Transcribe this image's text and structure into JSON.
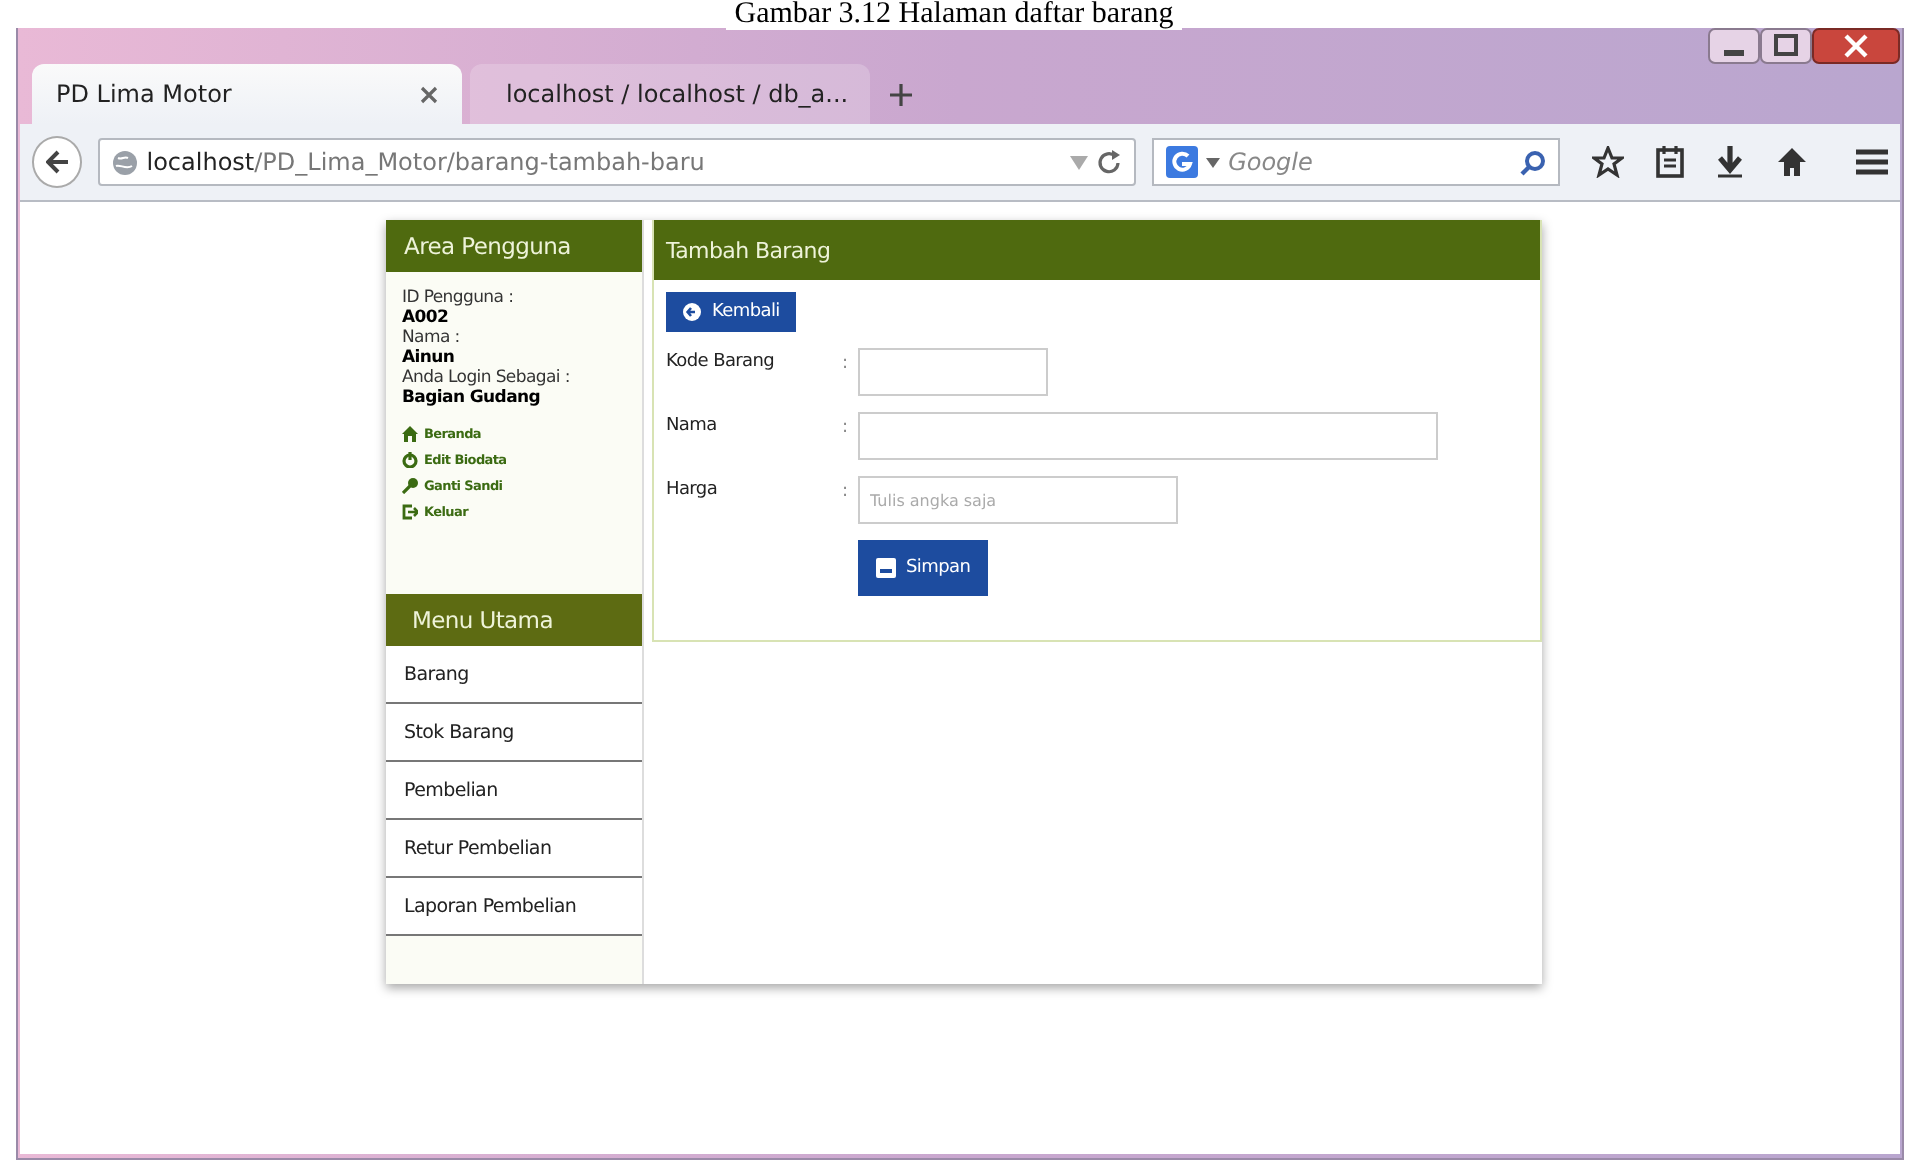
{
  "caption": "Gambar 3.12 Halaman daftar barang",
  "tabs": [
    {
      "label": "PD Lima Motor",
      "selected": true
    },
    {
      "label": "localhost / localhost / db_a...",
      "selected": false
    }
  ],
  "address_bar": {
    "host": "localhost",
    "path": "/PD_Lima_Motor/barang-tambah-baru"
  },
  "search": {
    "placeholder": "Google"
  },
  "user_area": {
    "title": "Area Pengguna",
    "fields": [
      {
        "label": "ID Pengguna :",
        "value": "A002"
      },
      {
        "label": "Nama :",
        "value": "Ainun"
      },
      {
        "label": "Anda Login Sebagai :",
        "value": "Bagian Gudang"
      }
    ],
    "links": [
      "Beranda",
      "Edit Biodata",
      "Ganti Sandi",
      "Keluar"
    ]
  },
  "menu": {
    "title": "Menu Utama",
    "items": [
      "Barang",
      "Stok Barang",
      "Pembelian",
      "Retur Pembelian",
      "Laporan Pembelian"
    ]
  },
  "form": {
    "title": "Tambah Barang",
    "back_button": "Kembali",
    "fields": [
      {
        "label": "Kode Barang",
        "separator": ":"
      },
      {
        "label": "Nama",
        "separator": ":"
      },
      {
        "label": "Harga",
        "separator": ":",
        "placeholder": "Tulis angka saja"
      }
    ],
    "submit_button": "Simpan"
  }
}
